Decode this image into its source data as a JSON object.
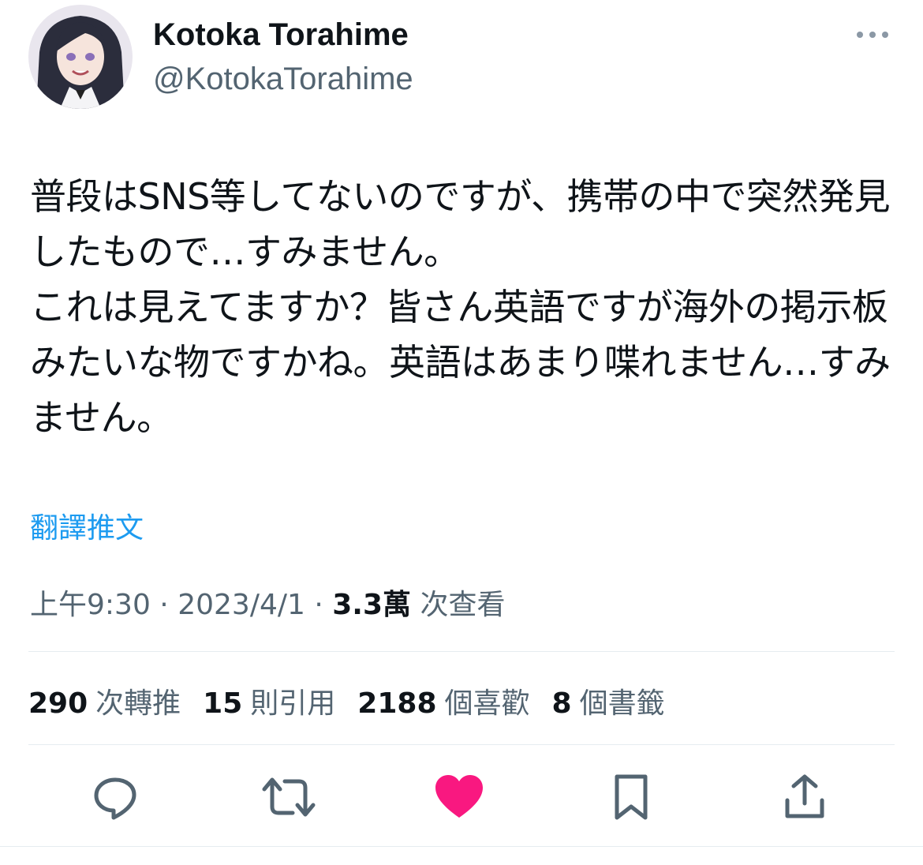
{
  "author": {
    "display_name": "Kotoka Torahime",
    "handle": "@KotokaTorahime",
    "avatar_icon": "avatar-image"
  },
  "tweet": {
    "text": "普段はSNS等してないのですが、携帯の中で突然発見したもので…すみません。\nこれは見えてますか？皆さん英語ですが海外の掲示板みたいな物ですかね。英語はあまり喋れません…すみません。",
    "translate_label": "翻譯推文"
  },
  "meta": {
    "time": "上午9:30",
    "separator": "·",
    "date": "2023/4/1",
    "views_value": "3.3萬",
    "views_label": "次查看"
  },
  "stats": {
    "retweets_value": "290",
    "retweets_label": "次轉推",
    "quotes_value": "15",
    "quotes_label": "則引用",
    "likes_value": "2188",
    "likes_label": "個喜歡",
    "bookmarks_value": "8",
    "bookmarks_label": "個書籤"
  },
  "actions": {
    "reply_icon": "reply-icon",
    "retweet_icon": "retweet-icon",
    "like_icon": "heart-icon",
    "bookmark_icon": "bookmark-icon",
    "share_icon": "share-icon"
  },
  "colors": {
    "text": "#0f1419",
    "secondary": "#536471",
    "link": "#1d9bf0",
    "like": "#f91880",
    "divider": "#e6ecf0"
  }
}
